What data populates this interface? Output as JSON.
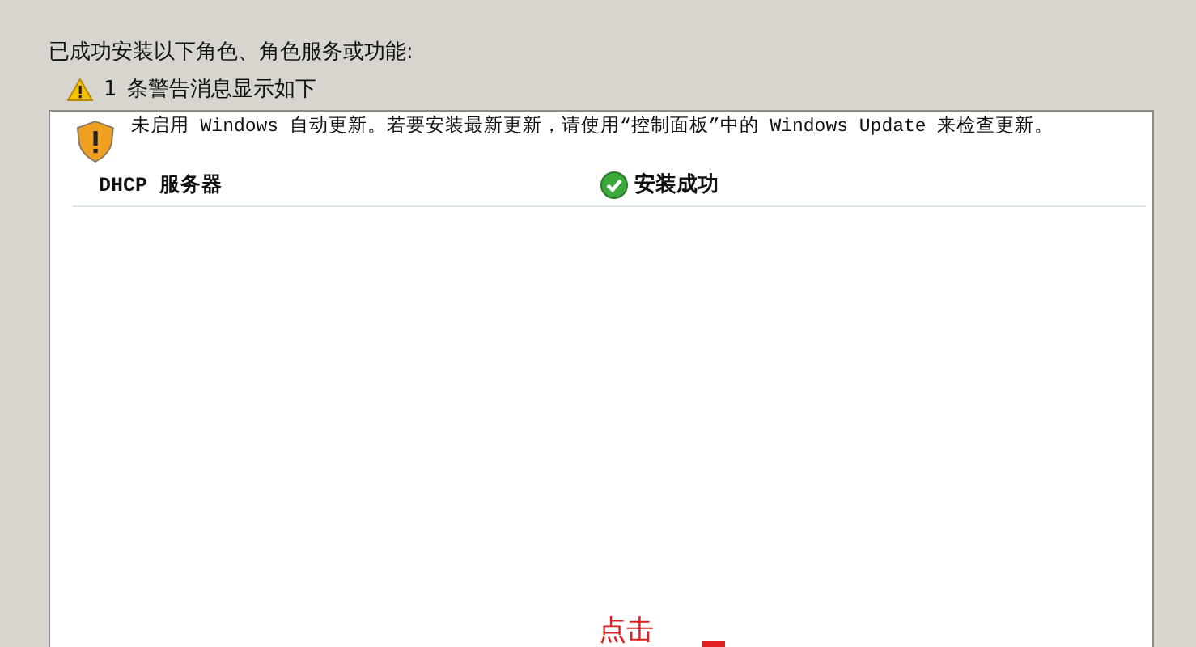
{
  "heading": "已成功安装以下角色、角色服务或功能:",
  "warning_summary": {
    "count": "1",
    "text": "条警告消息显示如下"
  },
  "results": {
    "message": "未启用 Windows 自动更新。若要安装最新更新，请使用“控制面板”中的 Windows Update 来检查更新。",
    "items": [
      {
        "name": "DHCP 服务器",
        "status": "安装成功",
        "kind": "success"
      }
    ]
  },
  "annotation": "点击"
}
